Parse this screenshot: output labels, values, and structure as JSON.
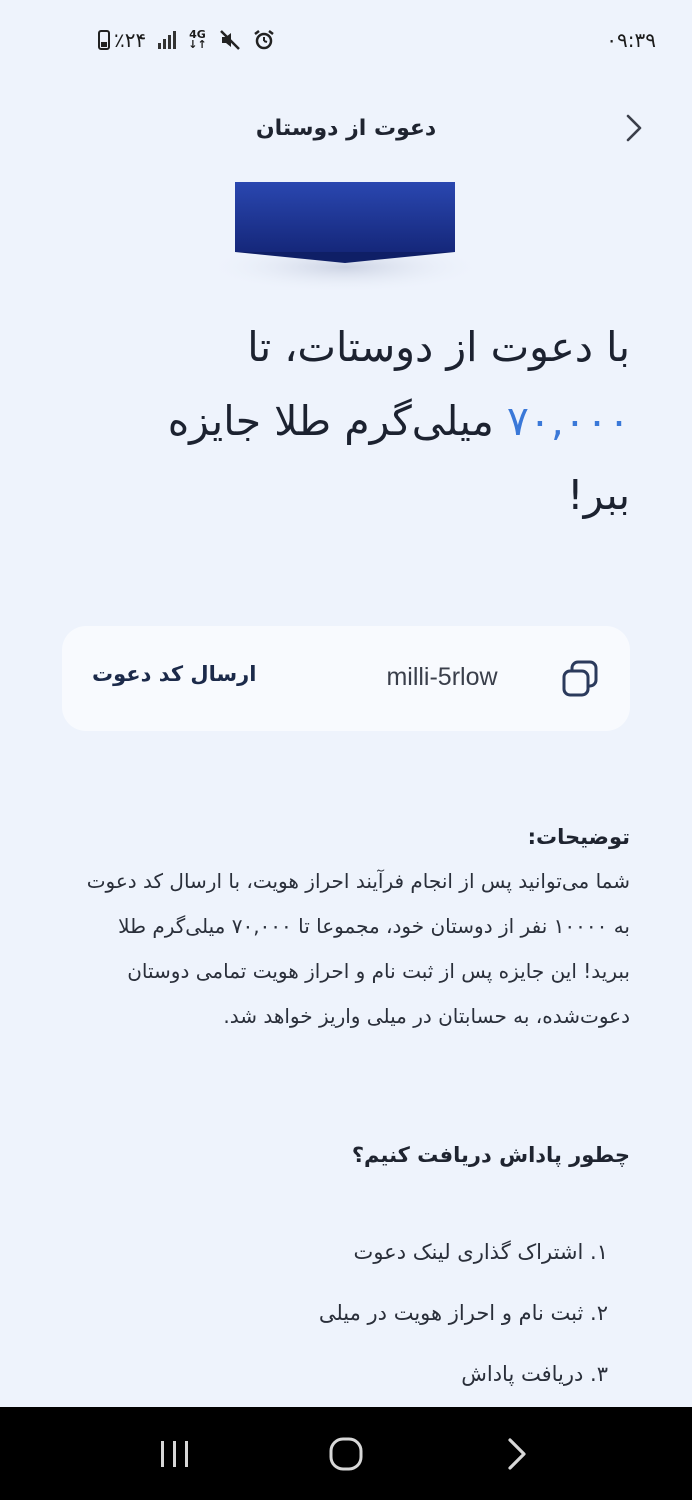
{
  "status_bar": {
    "time": "۰۹:۳۹",
    "battery": "٪۲۴",
    "network": "4G"
  },
  "header": {
    "title": "دعوت از دوستان"
  },
  "headline": {
    "line1": "با دعوت از دوستات، تا",
    "amount": "۷۰,۰۰۰",
    "line2_rest": "میلی‌گرم طلا جایزه",
    "line3": "ببر!"
  },
  "invite": {
    "code": "milli-5rlow",
    "send_label": "ارسال کد دعوت"
  },
  "description": {
    "title": "توضیحات:",
    "body": "شما می‌توانید پس از انجام فرآیند احراز هویت، با ارسال کد دعوت به ۱۰۰۰۰ نفر از دوستان خود، مجموعا تا ۷۰,۰۰۰ میلی‌گرم طلا ببرید! این جایزه پس از ثبت نام و احراز هویت تمامی دوستان دعوت‌شده، به حسابتان در میلی واریز خواهد شد."
  },
  "how": {
    "title": "چطور پاداش دریافت کنیم؟",
    "steps": [
      "۱. اشتراک گذاری لینک دعوت",
      "۲. ثبت نام و احراز هویت در میلی",
      "۳. دریافت پاداش"
    ]
  },
  "icons": {
    "back": "chevron-right-icon",
    "copy": "copy-icon",
    "nav_recents": "recents-icon",
    "nav_home": "home-icon",
    "nav_back": "back-icon"
  },
  "colors": {
    "background": "#eef3fc",
    "accent": "#3a78d8",
    "card": "#f8fafe",
    "hero_box": "#1f3a9a"
  }
}
